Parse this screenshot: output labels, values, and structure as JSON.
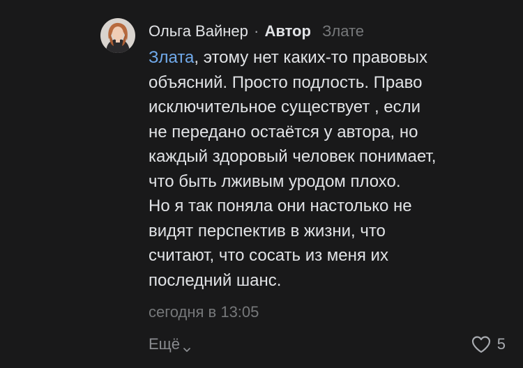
{
  "comment": {
    "author_name": "Ольга Вайнер",
    "separator": "·",
    "author_badge": "Автор",
    "reply_to": "Злате",
    "mention": "Злата",
    "text_lines": [
      ", этому нет каких-то правовых",
      "объясний. Просто подлость. Право",
      "исключительное существует , если",
      "не передано остаётся у автора, но",
      "каждый здоровый человек понимает,",
      "что быть лживым уродом плохо.",
      "Но я так поняла они настолько не",
      "видят перспектив в жизни, что",
      "считают, что сосать из меня их",
      "последний шанс."
    ],
    "timestamp": "сегодня в 13:05",
    "more_label": "Ещё",
    "likes_count": "5"
  },
  "icons": {
    "avatar": "avatar-photo",
    "more_chevron": "chevron-down-icon",
    "like": "heart-icon"
  },
  "colors": {
    "background": "#19191a",
    "text": "#e1e3e6",
    "mention": "#71aaeb",
    "secondary": "#76787a"
  }
}
